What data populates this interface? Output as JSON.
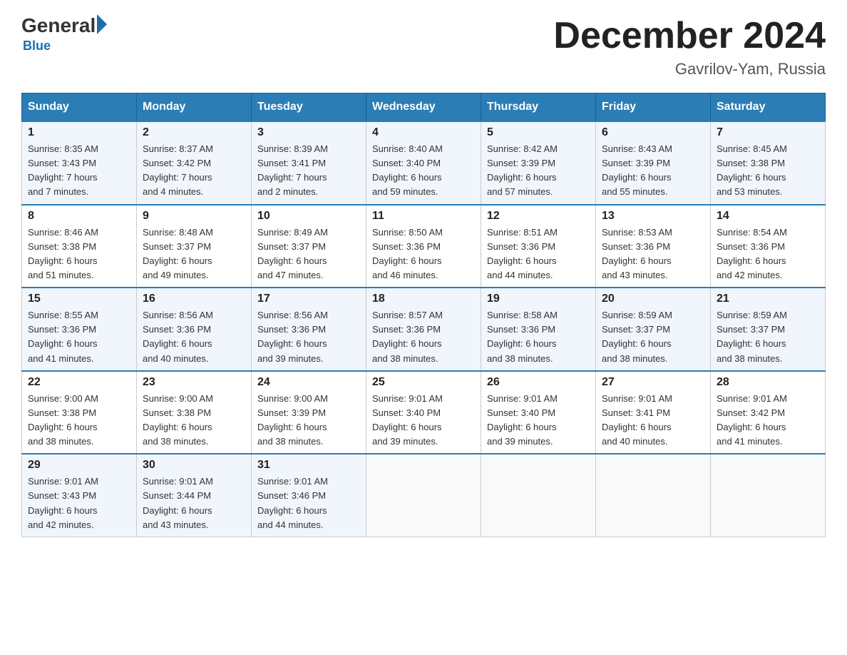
{
  "header": {
    "logo": {
      "general": "General",
      "blue": "Blue",
      "sub": "Blue"
    },
    "title": "December 2024",
    "location": "Gavrilov-Yam, Russia"
  },
  "days_of_week": [
    "Sunday",
    "Monday",
    "Tuesday",
    "Wednesday",
    "Thursday",
    "Friday",
    "Saturday"
  ],
  "weeks": [
    [
      {
        "day": "1",
        "sunrise": "8:35 AM",
        "sunset": "3:43 PM",
        "daylight": "7 hours and 7 minutes."
      },
      {
        "day": "2",
        "sunrise": "8:37 AM",
        "sunset": "3:42 PM",
        "daylight": "7 hours and 4 minutes."
      },
      {
        "day": "3",
        "sunrise": "8:39 AM",
        "sunset": "3:41 PM",
        "daylight": "7 hours and 2 minutes."
      },
      {
        "day": "4",
        "sunrise": "8:40 AM",
        "sunset": "3:40 PM",
        "daylight": "6 hours and 59 minutes."
      },
      {
        "day": "5",
        "sunrise": "8:42 AM",
        "sunset": "3:39 PM",
        "daylight": "6 hours and 57 minutes."
      },
      {
        "day": "6",
        "sunrise": "8:43 AM",
        "sunset": "3:39 PM",
        "daylight": "6 hours and 55 minutes."
      },
      {
        "day": "7",
        "sunrise": "8:45 AM",
        "sunset": "3:38 PM",
        "daylight": "6 hours and 53 minutes."
      }
    ],
    [
      {
        "day": "8",
        "sunrise": "8:46 AM",
        "sunset": "3:38 PM",
        "daylight": "6 hours and 51 minutes."
      },
      {
        "day": "9",
        "sunrise": "8:48 AM",
        "sunset": "3:37 PM",
        "daylight": "6 hours and 49 minutes."
      },
      {
        "day": "10",
        "sunrise": "8:49 AM",
        "sunset": "3:37 PM",
        "daylight": "6 hours and 47 minutes."
      },
      {
        "day": "11",
        "sunrise": "8:50 AM",
        "sunset": "3:36 PM",
        "daylight": "6 hours and 46 minutes."
      },
      {
        "day": "12",
        "sunrise": "8:51 AM",
        "sunset": "3:36 PM",
        "daylight": "6 hours and 44 minutes."
      },
      {
        "day": "13",
        "sunrise": "8:53 AM",
        "sunset": "3:36 PM",
        "daylight": "6 hours and 43 minutes."
      },
      {
        "day": "14",
        "sunrise": "8:54 AM",
        "sunset": "3:36 PM",
        "daylight": "6 hours and 42 minutes."
      }
    ],
    [
      {
        "day": "15",
        "sunrise": "8:55 AM",
        "sunset": "3:36 PM",
        "daylight": "6 hours and 41 minutes."
      },
      {
        "day": "16",
        "sunrise": "8:56 AM",
        "sunset": "3:36 PM",
        "daylight": "6 hours and 40 minutes."
      },
      {
        "day": "17",
        "sunrise": "8:56 AM",
        "sunset": "3:36 PM",
        "daylight": "6 hours and 39 minutes."
      },
      {
        "day": "18",
        "sunrise": "8:57 AM",
        "sunset": "3:36 PM",
        "daylight": "6 hours and 38 minutes."
      },
      {
        "day": "19",
        "sunrise": "8:58 AM",
        "sunset": "3:36 PM",
        "daylight": "6 hours and 38 minutes."
      },
      {
        "day": "20",
        "sunrise": "8:59 AM",
        "sunset": "3:37 PM",
        "daylight": "6 hours and 38 minutes."
      },
      {
        "day": "21",
        "sunrise": "8:59 AM",
        "sunset": "3:37 PM",
        "daylight": "6 hours and 38 minutes."
      }
    ],
    [
      {
        "day": "22",
        "sunrise": "9:00 AM",
        "sunset": "3:38 PM",
        "daylight": "6 hours and 38 minutes."
      },
      {
        "day": "23",
        "sunrise": "9:00 AM",
        "sunset": "3:38 PM",
        "daylight": "6 hours and 38 minutes."
      },
      {
        "day": "24",
        "sunrise": "9:00 AM",
        "sunset": "3:39 PM",
        "daylight": "6 hours and 38 minutes."
      },
      {
        "day": "25",
        "sunrise": "9:01 AM",
        "sunset": "3:40 PM",
        "daylight": "6 hours and 39 minutes."
      },
      {
        "day": "26",
        "sunrise": "9:01 AM",
        "sunset": "3:40 PM",
        "daylight": "6 hours and 39 minutes."
      },
      {
        "day": "27",
        "sunrise": "9:01 AM",
        "sunset": "3:41 PM",
        "daylight": "6 hours and 40 minutes."
      },
      {
        "day": "28",
        "sunrise": "9:01 AM",
        "sunset": "3:42 PM",
        "daylight": "6 hours and 41 minutes."
      }
    ],
    [
      {
        "day": "29",
        "sunrise": "9:01 AM",
        "sunset": "3:43 PM",
        "daylight": "6 hours and 42 minutes."
      },
      {
        "day": "30",
        "sunrise": "9:01 AM",
        "sunset": "3:44 PM",
        "daylight": "6 hours and 43 minutes."
      },
      {
        "day": "31",
        "sunrise": "9:01 AM",
        "sunset": "3:46 PM",
        "daylight": "6 hours and 44 minutes."
      },
      null,
      null,
      null,
      null
    ]
  ]
}
